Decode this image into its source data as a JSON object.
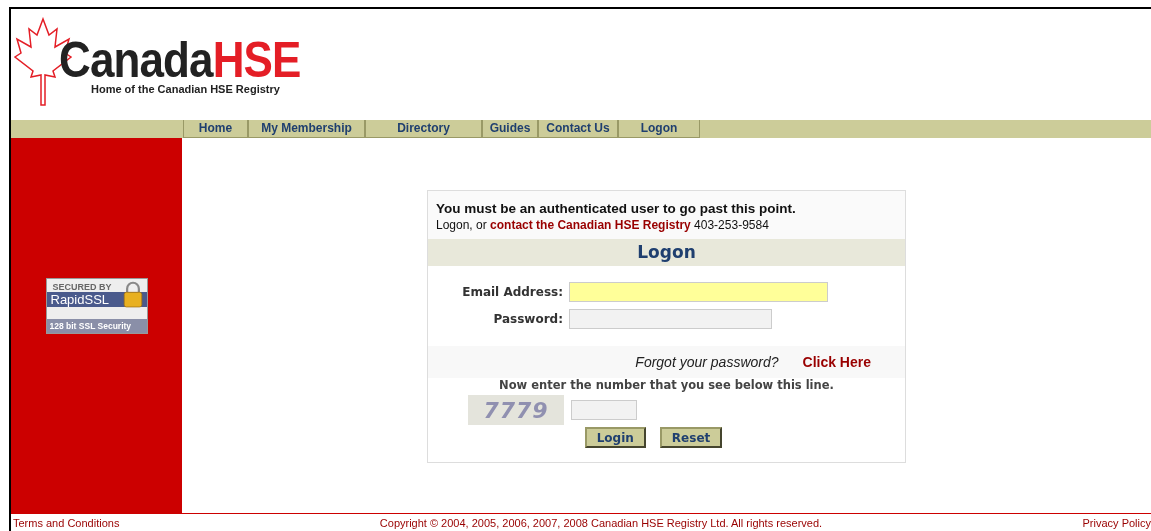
{
  "logo": {
    "word": "Canada",
    "accent": "HSE",
    "tagline": "Home of the Canadian HSE Registry"
  },
  "nav": [
    {
      "label": "Home"
    },
    {
      "label": "My Membership"
    },
    {
      "label": "Directory"
    },
    {
      "label": "Guides"
    },
    {
      "label": "Contact Us"
    },
    {
      "label": "Logon"
    }
  ],
  "ssl_badge": {
    "top": "SECURED BY",
    "brand": "RapidSSL",
    "bottom": "128 bit SSL Security"
  },
  "login": {
    "notice": "You must be an authenticated user to go past this point.",
    "intro": "Logon, or",
    "contact_link": "contact the Canadian HSE Registry",
    "phone": "403-253-9584",
    "heading": "Logon",
    "fields": [
      {
        "label": "Email Address:",
        "highlighted": true
      },
      {
        "label": "Password:",
        "highlighted": false
      }
    ],
    "forgot_text": "Forgot your password?",
    "forgot_link": "Click Here",
    "captcha_prompt": "Now enter the number that you see below this line.",
    "captcha_code": "7779",
    "buttons": [
      "Login",
      "Reset"
    ]
  },
  "footer": {
    "terms": "Terms and Conditions",
    "copyright": "Copyright © 2004, 2005, 2006, 2007, 2008 Canadian HSE Registry Ltd. All rights reserved.",
    "privacy": "Privacy Policy"
  }
}
